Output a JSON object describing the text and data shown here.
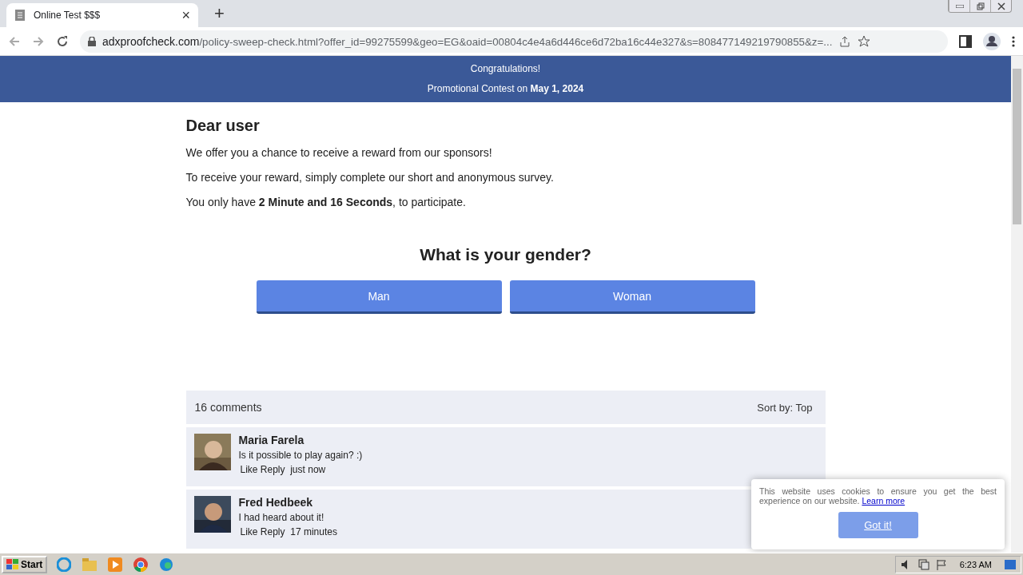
{
  "browser": {
    "tab": {
      "title": "Online Test $$$",
      "close": "×"
    },
    "new_tab": "+",
    "url_domain": "adxproofcheck.com",
    "url_path": "/policy-sweep-check.html?offer_id=99275599&geo=EG&oaid=00804c4e4a6d446ce6d72ba16c44e327&s=808477149219790855&z=..."
  },
  "banner": {
    "line1": "Congratulations!",
    "line2": "Promotional Contest on **May 1, 2024**"
  },
  "heading": "Dear user",
  "paragraphs": [
    "We offer you a chance to receive a reward from our sponsors!",
    "To receive your reward, simply complete our short and anonymous survey.",
    "You only have **2 Minute and 16 Seconds**, to participate."
  ],
  "question": "What is your gender?",
  "answers": [
    "Man",
    "Woman"
  ],
  "comments": {
    "count": "16 comments",
    "sort_label": "Sort by:",
    "sort_value": "Top",
    "items": [
      {
        "author": "Maria Farela",
        "text": "Is it possible to play again? :)",
        "actions": "Like Reply",
        "time": "just now"
      },
      {
        "author": "Fred Hedbeek",
        "text": "I had heard about it!",
        "actions": "Like Reply",
        "time": "17 minutes"
      }
    ]
  },
  "cookie": {
    "text": "This website uses cookies to ensure you get the best experience on our website.",
    "link": "Learn more",
    "button": "Got it!"
  },
  "taskbar": {
    "start": "Start",
    "time": "6:23 AM"
  }
}
